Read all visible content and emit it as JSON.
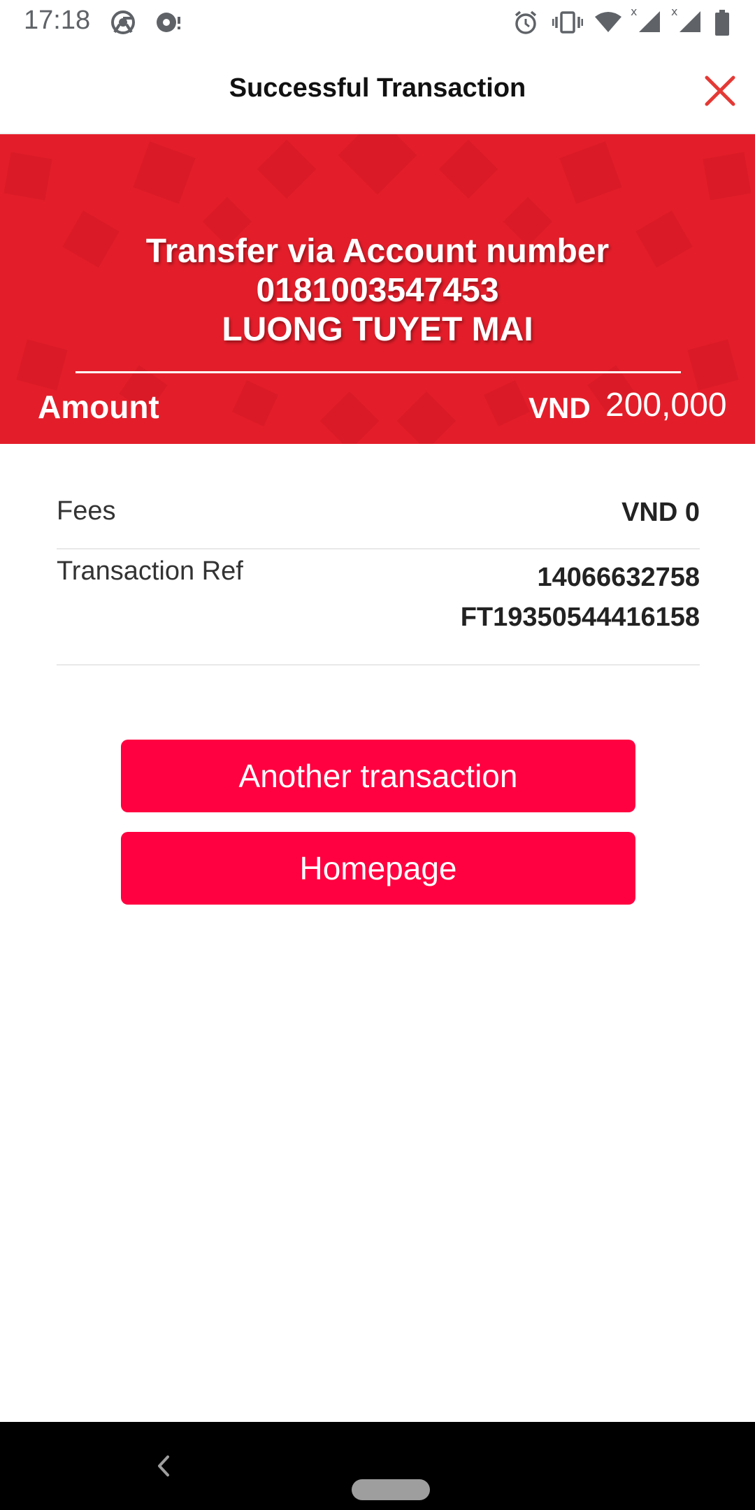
{
  "status_bar": {
    "time": "17:18"
  },
  "header": {
    "title": "Successful Transaction",
    "close_icon": "close-icon"
  },
  "hero": {
    "line1": "Transfer via Account number",
    "account_number": "0181003547453",
    "recipient_name": "LUONG TUYET MAI",
    "amount_label": "Amount",
    "currency": "VND",
    "amount": "200,000"
  },
  "details": {
    "fees_label": "Fees",
    "fees_value": "VND 0",
    "ref_label": "Transaction Ref",
    "ref_value_1": "14066632758",
    "ref_value_2": "FT19350544416158"
  },
  "actions": {
    "another_label": "Another transaction",
    "home_label": "Homepage"
  },
  "colors": {
    "brand_red": "#e31e2a",
    "button_red": "#ff0040",
    "close_red": "#e53935"
  }
}
